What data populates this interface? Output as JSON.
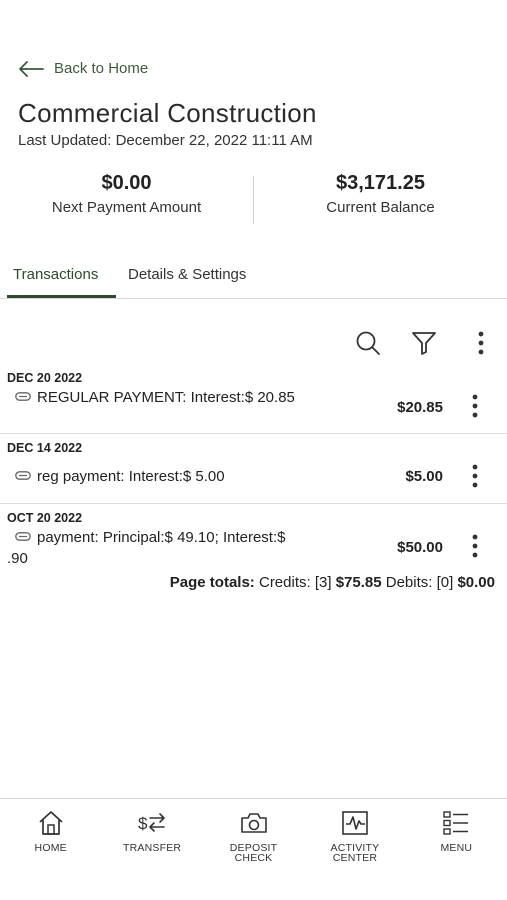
{
  "header": {
    "back_label": "Back to Home",
    "title": "Commercial Construction",
    "last_updated": "Last Updated: December 22, 2022 11:11 AM"
  },
  "summary": {
    "next_payment_amount": "$0.00",
    "next_payment_label": "Next Payment Amount",
    "current_balance": "$3,171.25",
    "current_balance_label": "Current Balance"
  },
  "tabs": [
    {
      "label": "Transactions",
      "active": true
    },
    {
      "label": "Details & Settings",
      "active": false
    }
  ],
  "toolbar": {
    "icons": [
      "search-icon",
      "filter-icon",
      "more-vertical-icon"
    ]
  },
  "transactions": [
    {
      "date": "DEC 20 2022",
      "description": "REGULAR PAYMENT: Interest:$ 20.85",
      "amount": "$20.85"
    },
    {
      "date": "DEC 14 2022",
      "description": "reg payment: Interest:$ 5.00",
      "amount": "$5.00"
    },
    {
      "date": "OCT 20 2022",
      "description": "payment: Principal:$ 49.10; Interest:$ .90",
      "amount": "$50.00"
    }
  ],
  "page_totals": {
    "label": "Page totals:",
    "credits_label": "Credits: [3]",
    "credits_amount": "$75.85",
    "debits_label": "Debits: [0]",
    "debits_amount": "$0.00"
  },
  "bottom_nav": [
    {
      "label": "HOME",
      "icon": "home-icon"
    },
    {
      "label": "TRANSFER",
      "icon": "transfer-icon"
    },
    {
      "label": "DEPOSIT\nCHECK",
      "icon": "camera-icon"
    },
    {
      "label": "ACTIVITY\nCENTER",
      "icon": "activity-icon"
    },
    {
      "label": "MENU",
      "icon": "menu-icon"
    }
  ],
  "colors": {
    "accent": "#2e4a2e",
    "text": "#222222",
    "divider": "#d9d9d9"
  }
}
